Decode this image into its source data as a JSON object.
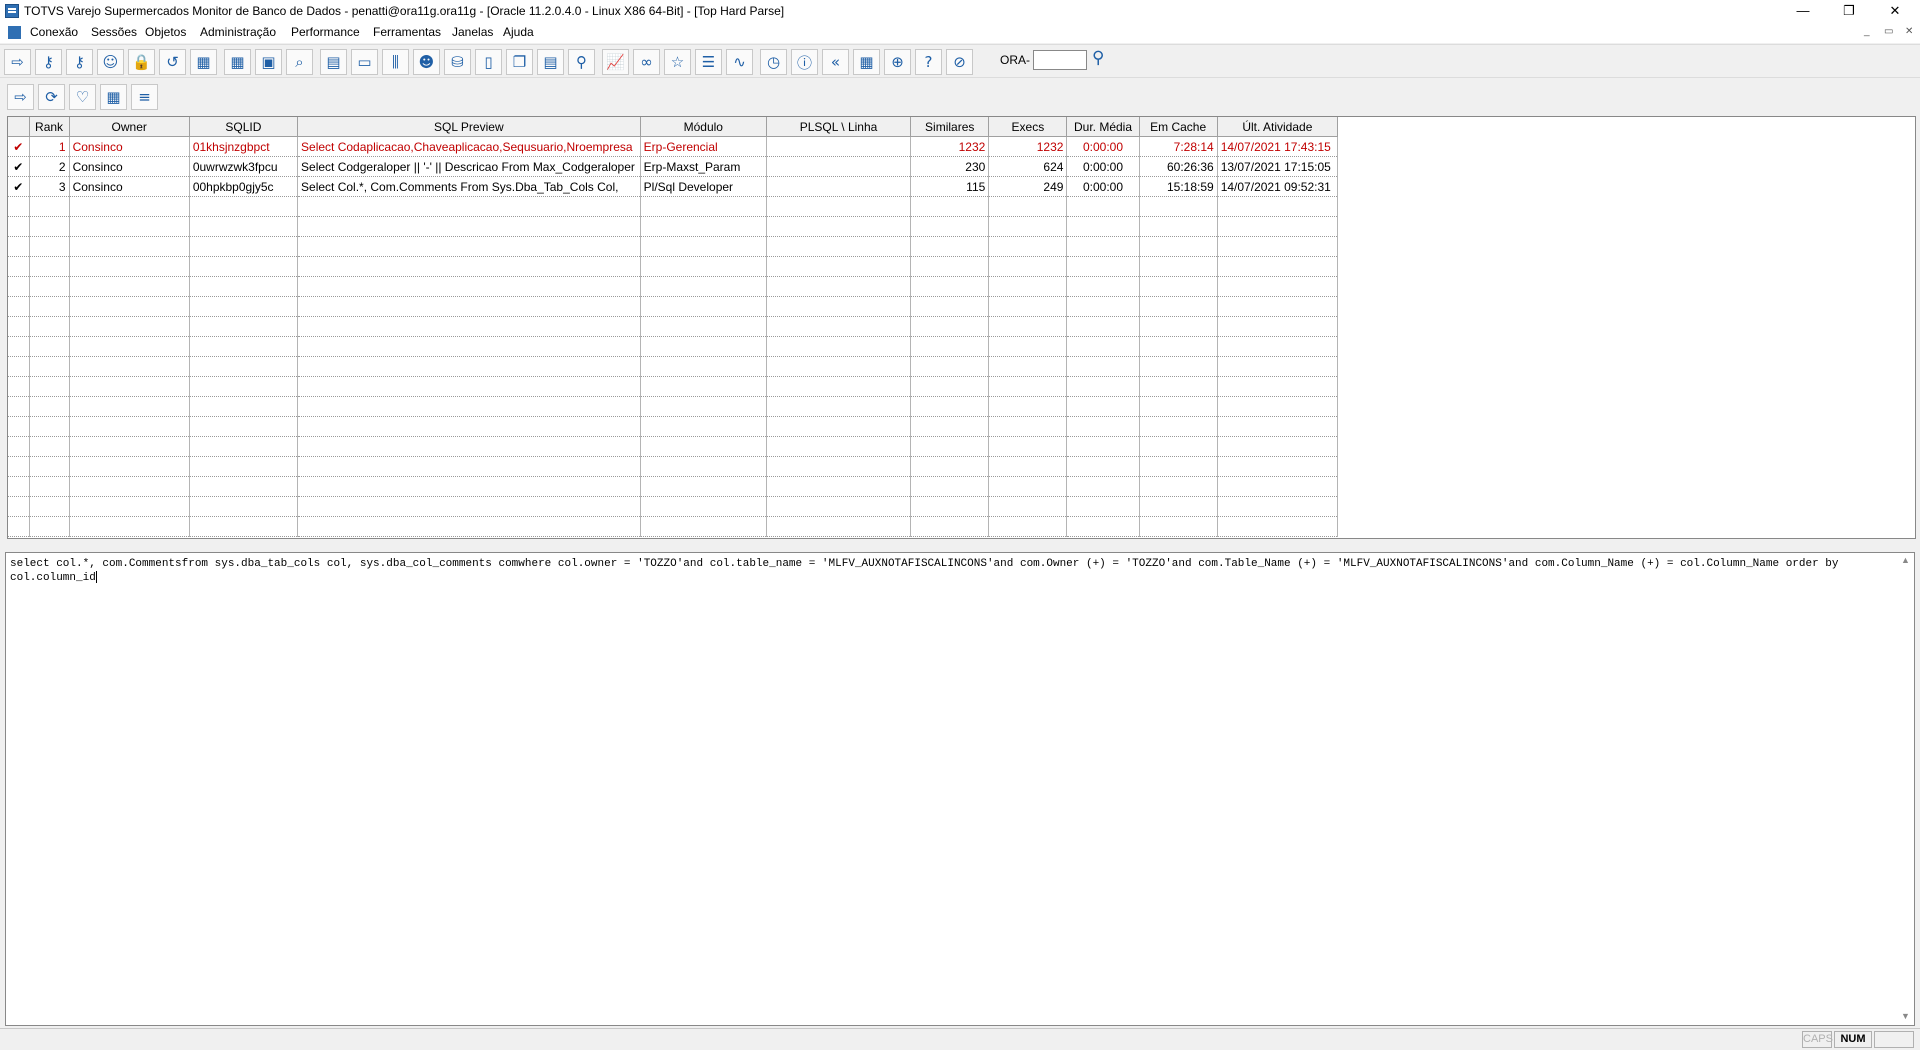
{
  "window": {
    "title": "TOTVS Varejo Supermercados Monitor de Banco de Dados - penatti@ora11g.ora11g - [Oracle 11.2.0.4.0 - Linux X86 64-Bit] - [Top Hard Parse]",
    "minimize": "—",
    "restore": "❐",
    "close": "✕"
  },
  "menu": [
    "Conexão",
    "Sessões",
    "Objetos",
    "Administração",
    "Performance",
    "Ferramentas",
    "Janelas",
    "Ajuda"
  ],
  "mdi_controls": [
    "_",
    "▭",
    "✕"
  ],
  "toolbar": {
    "icons": [
      "exit-icon",
      "key-icon",
      "key-search-icon",
      "user-icon",
      "lock-icon",
      "history-icon",
      "calendar-icon",
      "calendar-settings-icon",
      "package-icon",
      "zoom-icon",
      "report-icon",
      "storage-icon",
      "sliders-icon",
      "users-icon",
      "database-icon",
      "document-icon",
      "documents-icon",
      "text-document-icon",
      "plugin-icon",
      "chart-icon",
      "link-icon",
      "star-icon",
      "list-icon",
      "pulse-icon",
      "clock-icon",
      "info-icon",
      "rewind-icon",
      "calculator-icon",
      "globe-icon",
      "help-icon",
      "stop-icon"
    ],
    "glyphs": [
      "⇨",
      "⚷",
      "⚷",
      "☺",
      "🔒",
      "↺",
      "▦",
      "▦",
      "▣",
      "⌕",
      "▤",
      "▭",
      "⫼",
      "☻",
      "⛁",
      "▯",
      "❐",
      "▤",
      "⚲",
      "📈",
      "∞",
      "☆",
      "☰",
      "∿",
      "◷",
      "ⓘ",
      "«",
      "▦",
      "⊕",
      "?",
      "⊘"
    ],
    "ora_label": "ORA-",
    "ora_value": "",
    "search_icon": "search-icon",
    "search_glyph": "⚲"
  },
  "subtoolbar": {
    "icons": [
      "exit-icon",
      "refresh-icon",
      "lightbulb-icon",
      "calendar-icon",
      "list-icon"
    ],
    "glyphs": [
      "⇨",
      "⟳",
      "♡",
      "▦",
      "≡"
    ]
  },
  "grid": {
    "columns": [
      "",
      "Rank",
      "Owner",
      "SQLID",
      "SQL Preview",
      "Módulo",
      "PLSQL \\ Linha",
      "Similares",
      "Execs",
      "Dur. Média",
      "Em Cache",
      "Últ. Atividade"
    ],
    "rows": [
      {
        "check": "✔",
        "rank": "1",
        "owner": "Consinco",
        "sqlid": "01khsjnzgbpct",
        "preview": "Select Codaplicacao,Chaveaplicacao,Sequsuario,Nroempresa",
        "module": "Erp-Gerencial",
        "plsql": "",
        "similares": "1232",
        "execs": "1232",
        "dur": "0:00:00",
        "cache": "7:28:14",
        "last": "14/07/2021 17:43:15",
        "highlight": true
      },
      {
        "check": "✔",
        "rank": "2",
        "owner": "Consinco",
        "sqlid": "0uwrwzwk3fpcu",
        "preview": "Select Codgeraloper || '-' || Descricao From Max_Codgeraloper",
        "module": "Erp-Maxst_Param",
        "plsql": "",
        "similares": "230",
        "execs": "624",
        "dur": "0:00:00",
        "cache": "60:26:36",
        "last": "13/07/2021 17:15:05",
        "highlight": false
      },
      {
        "check": "✔",
        "rank": "3",
        "owner": "Consinco",
        "sqlid": "00hpkbp0gjy5c",
        "preview": "Select Col.*, Com.Comments From Sys.Dba_Tab_Cols Col,",
        "module": "Pl/Sql Developer",
        "plsql": "",
        "similares": "115",
        "execs": "249",
        "dur": "0:00:00",
        "cache": "15:18:59",
        "last": "14/07/2021 09:52:31",
        "highlight": false
      }
    ],
    "highlight_color": "#c00000"
  },
  "editor": {
    "sql": "select col.*, com.Commentsfrom sys.dba_tab_cols col, sys.dba_col_comments comwhere col.owner = 'TOZZO'and col.table_name = 'MLFV_AUXNOTAFISCALINCONS'and com.Owner (+) = 'TOZZO'and com.Table_Name (+) = 'MLFV_AUXNOTAFISCALINCONS'and com.Column_Name (+) = col.Column_Name order by col.column_id"
  },
  "statusbar": {
    "caps": "CAPS",
    "num": "NUM"
  }
}
